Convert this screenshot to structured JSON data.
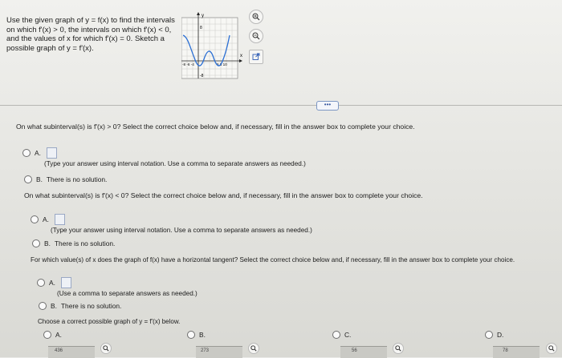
{
  "problem": {
    "lines": [
      "Use the given graph of y = f(x) to find the intervals",
      "on which f'(x) > 0, the intervals on which f'(x) < 0,",
      "and the values of x for which f'(x) = 0. Sketch a",
      "possible graph of y = f'(x)."
    ]
  },
  "graph": {
    "y_axis_label": "y",
    "x_axis_label": "x",
    "y_tick_top": "8",
    "y_tick_bottom": "-8",
    "x_ticks_left": "-8 -6 -4",
    "x_ticks_right": "6 8 10",
    "zoom_in_icon": "zoom-in-icon",
    "zoom_out_icon": "zoom-out-icon",
    "popout_icon": "external-link-icon"
  },
  "more_button": "•••",
  "part1": {
    "question": "On what subinterval(s) is f'(x) > 0? Select the correct choice below and, if necessary, fill in the answer box to complete your choice.",
    "option_a_label": "A.",
    "option_a_note": "(Type your answer using interval notation. Use a comma to separate answers as needed.)",
    "option_b_label": "B.",
    "option_b_text": "There is no solution."
  },
  "part2": {
    "question": "On what subinterval(s) is f'(x) < 0? Select the correct choice below and, if necessary, fill in the answer box to complete your choice.",
    "option_a_label": "A.",
    "option_a_note": "(Type your answer using interval notation. Use a comma to separate answers as needed.)",
    "option_b_label": "B.",
    "option_b_text": "There is no solution."
  },
  "part3": {
    "question": "For which value(s) of x does the graph of f(x) have a horizontal tangent? Select the correct choice below and, if necessary, fill in the answer box to complete your choice.",
    "option_a_label": "A.",
    "option_a_note": "(Use a comma to separate answers as needed.)",
    "option_b_label": "B.",
    "option_b_text": "There is no solution."
  },
  "part4": {
    "question": "Choose a correct possible graph of y = f'(x) below.",
    "choices": [
      {
        "label": "A.",
        "tick": "436"
      },
      {
        "label": "B.",
        "tick": "273"
      },
      {
        "label": "C.",
        "tick": "56"
      },
      {
        "label": "D.",
        "tick": "78"
      }
    ]
  },
  "colors": {
    "answer_box_border": "#9aa8c4",
    "more_button": "#3b5aa0"
  }
}
